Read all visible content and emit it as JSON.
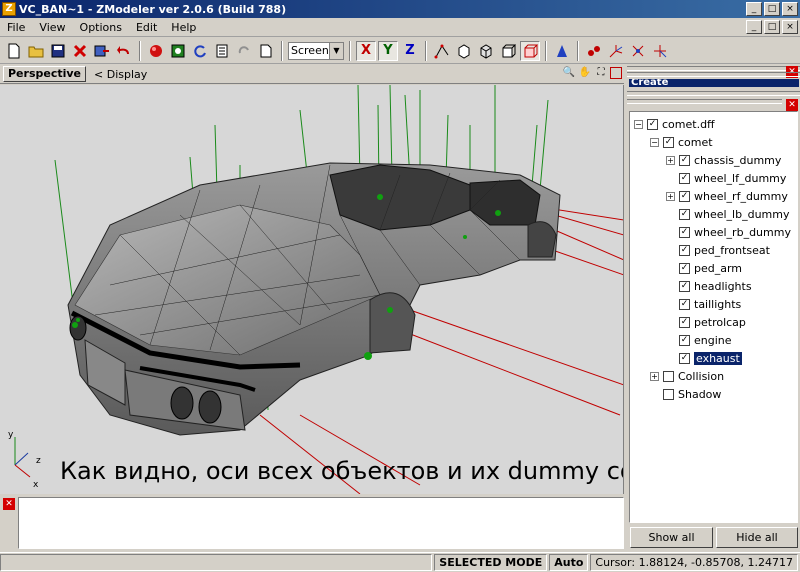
{
  "window": {
    "title": "VC_BAN~1 - ZModeler ver 2.0.6 (Build 788)",
    "app_icon_letter": "Z",
    "minimize": "_",
    "maximize": "□",
    "close": "×"
  },
  "menu": {
    "items": [
      "File",
      "View",
      "Options",
      "Edit",
      "Help"
    ]
  },
  "toolbar": {
    "view_mode": "Screen",
    "axis_x": "X",
    "axis_y": "Y",
    "axis_z": "Z"
  },
  "viewport": {
    "tab": "Perspective",
    "display": "< Display",
    "caption": "Как видно, оси всех объектов и их dummy совпадают",
    "axis_gizmo": {
      "y": "y",
      "z": "z",
      "x": "x"
    }
  },
  "scene_tree": {
    "panel_title": "Create",
    "items": [
      {
        "label": "comet.dff",
        "level": 0,
        "expander": "−",
        "checked": true
      },
      {
        "label": "comet",
        "level": 1,
        "expander": "−",
        "checked": true
      },
      {
        "label": "chassis_dummy",
        "level": 2,
        "expander": "+",
        "checked": true
      },
      {
        "label": "wheel_lf_dummy",
        "level": 2,
        "expander": "",
        "checked": true
      },
      {
        "label": "wheel_rf_dummy",
        "level": 2,
        "expander": "+",
        "checked": true
      },
      {
        "label": "wheel_lb_dummy",
        "level": 2,
        "expander": "",
        "checked": true
      },
      {
        "label": "wheel_rb_dummy",
        "level": 2,
        "expander": "",
        "checked": true
      },
      {
        "label": "ped_frontseat",
        "level": 2,
        "expander": "",
        "checked": true
      },
      {
        "label": "ped_arm",
        "level": 2,
        "expander": "",
        "checked": true
      },
      {
        "label": "headlights",
        "level": 2,
        "expander": "",
        "checked": true
      },
      {
        "label": "taillights",
        "level": 2,
        "expander": "",
        "checked": true
      },
      {
        "label": "petrolcap",
        "level": 2,
        "expander": "",
        "checked": true
      },
      {
        "label": "engine",
        "level": 2,
        "expander": "",
        "checked": true
      },
      {
        "label": "exhaust",
        "level": 2,
        "expander": "",
        "checked": true,
        "selected": true
      },
      {
        "label": "Collision",
        "level": 1,
        "expander": "+",
        "checked": false
      },
      {
        "label": "Shadow",
        "level": 1,
        "expander": "",
        "checked": false
      }
    ],
    "show_all": "Show all",
    "hide_all": "Hide all"
  },
  "status": {
    "mode": "SELECTED MODE",
    "auto": "Auto",
    "cursor": "Cursor: 1.88124, -0.85708, 1.24717"
  }
}
